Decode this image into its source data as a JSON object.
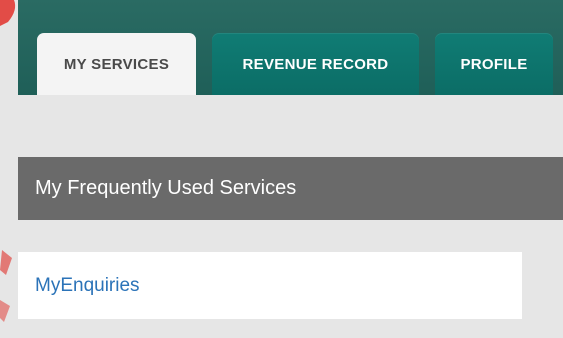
{
  "tabs": [
    {
      "label": "MY SERVICES",
      "active": true
    },
    {
      "label": "REVENUE RECORD",
      "active": false
    },
    {
      "label": "PROFILE",
      "active": false
    }
  ],
  "frequent_services": {
    "title": "My Frequently Used Services",
    "items": [
      {
        "label": "MyEnquiries"
      }
    ]
  },
  "colors": {
    "nav_bar": "#1f5f58",
    "tab_inactive": "#0b6d66",
    "tab_active": "#f4f4f4",
    "section_header": "#6a6a6a",
    "link": "#2b73b8",
    "page_background": "#e6e6e6",
    "logo_accent": "#e0302a"
  },
  "icons": [
    "logo-watermark-icon"
  ]
}
